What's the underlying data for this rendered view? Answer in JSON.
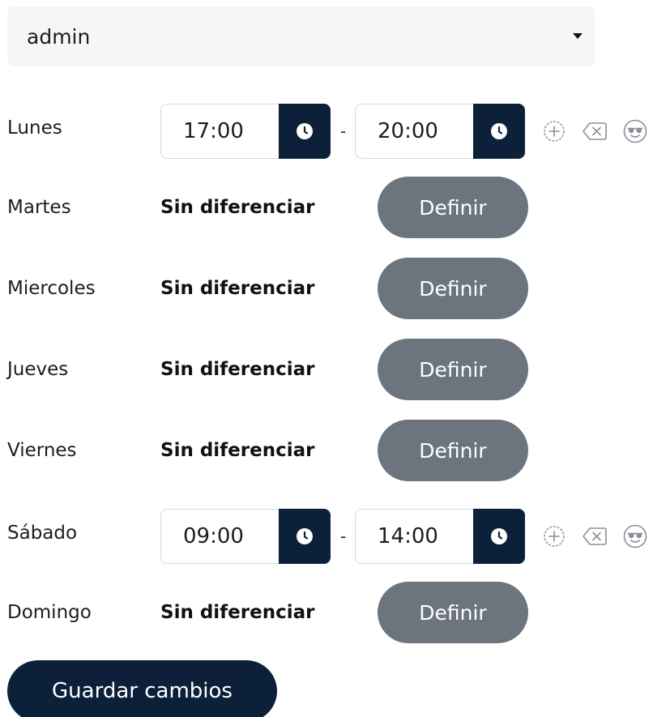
{
  "user_select": {
    "value": "admin"
  },
  "schedule": {
    "dash": "-",
    "days": [
      {
        "label": "Lunes",
        "mode": "times",
        "from": "17:00",
        "to": "20:00"
      },
      {
        "label": "Martes",
        "mode": "undifferentiated",
        "status": "Sin diferenciar",
        "button": "Definir"
      },
      {
        "label": "Miercoles",
        "mode": "undifferentiated",
        "status": "Sin diferenciar",
        "button": "Definir"
      },
      {
        "label": "Jueves",
        "mode": "undifferentiated",
        "status": "Sin diferenciar",
        "button": "Definir"
      },
      {
        "label": "Viernes",
        "mode": "undifferentiated",
        "status": "Sin diferenciar",
        "button": "Definir"
      },
      {
        "label": "Sábado",
        "mode": "times",
        "from": "09:00",
        "to": "14:00"
      },
      {
        "label": "Domingo",
        "mode": "undifferentiated",
        "status": "Sin diferenciar",
        "button": "Definir"
      }
    ]
  },
  "icons": {
    "time_picker": "clock-icon",
    "add": "add-circle-icon",
    "remove": "backspace-icon",
    "extra": "smiley-sunglasses-icon"
  },
  "colors": {
    "primary": "#0c2139",
    "secondary_button": "#6c757d",
    "select_bg": "#f5f6f8"
  },
  "footer": {
    "save_label": "Guardar cambios"
  }
}
